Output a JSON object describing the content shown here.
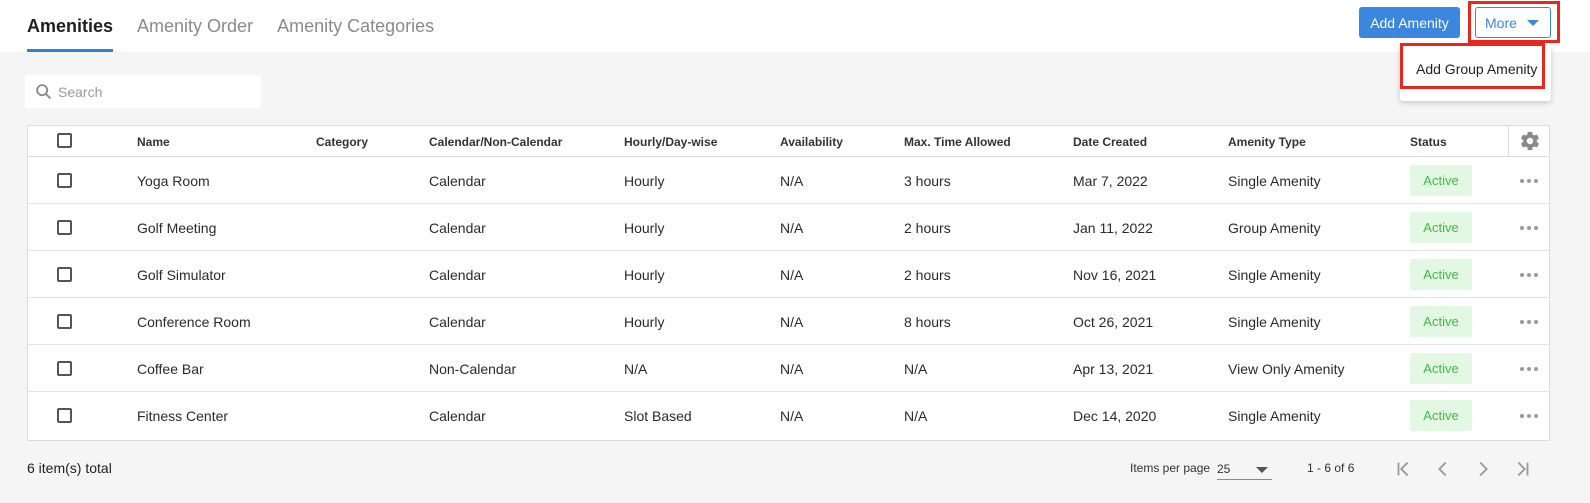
{
  "tabs": [
    {
      "label": "Amenities",
      "active": true
    },
    {
      "label": "Amenity Order",
      "active": false
    },
    {
      "label": "Amenity Categories",
      "active": false
    }
  ],
  "header": {
    "add_button": "Add Amenity",
    "more_button": "More",
    "dropdown_items": [
      "Add Group Amenity"
    ]
  },
  "search": {
    "placeholder": "Search",
    "value": ""
  },
  "table": {
    "columns": [
      "Name",
      "Category",
      "Calendar/Non-Calendar",
      "Hourly/Day-wise",
      "Availability",
      "Max. Time Allowed",
      "Date Created",
      "Amenity Type",
      "Status"
    ],
    "rows": [
      {
        "name": "Yoga Room",
        "category": "",
        "calendar": "Calendar",
        "hourly": "Hourly",
        "availability": "N/A",
        "max_time": "3 hours",
        "date_created": "Mar 7, 2022",
        "type": "Single Amenity",
        "status": "Active"
      },
      {
        "name": "Golf Meeting",
        "category": "",
        "calendar": "Calendar",
        "hourly": "Hourly",
        "availability": "N/A",
        "max_time": "2 hours",
        "date_created": "Jan 11, 2022",
        "type": "Group Amenity",
        "status": "Active"
      },
      {
        "name": "Golf Simulator",
        "category": "",
        "calendar": "Calendar",
        "hourly": "Hourly",
        "availability": "N/A",
        "max_time": "2 hours",
        "date_created": "Nov 16, 2021",
        "type": "Single Amenity",
        "status": "Active"
      },
      {
        "name": "Conference Room",
        "category": "",
        "calendar": "Calendar",
        "hourly": "Hourly",
        "availability": "N/A",
        "max_time": "8 hours",
        "date_created": "Oct 26, 2021",
        "type": "Single Amenity",
        "status": "Active"
      },
      {
        "name": "Coffee Bar",
        "category": "",
        "calendar": "Non-Calendar",
        "hourly": "N/A",
        "availability": "N/A",
        "max_time": "N/A",
        "date_created": "Apr 13, 2021",
        "type": "View Only Amenity",
        "status": "Active"
      },
      {
        "name": "Fitness Center",
        "category": "",
        "calendar": "Calendar",
        "hourly": "Slot Based",
        "availability": "N/A",
        "max_time": "N/A",
        "date_created": "Dec 14, 2020",
        "type": "Single Amenity",
        "status": "Active"
      }
    ]
  },
  "footer": {
    "total": "6 item(s) total",
    "items_per_page_label": "Items per page",
    "items_per_page": "25",
    "range": "1 - 6 of 6"
  },
  "colors": {
    "primary": "#3b87e0",
    "highlight": "#e8281d",
    "status_bg": "#e3f8e3",
    "status_text": "#42b847"
  },
  "icons": [
    "search-icon",
    "gear-icon",
    "more-options-icon",
    "chevron-down-icon",
    "first-page-icon",
    "prev-page-icon",
    "next-page-icon",
    "last-page-icon"
  ]
}
